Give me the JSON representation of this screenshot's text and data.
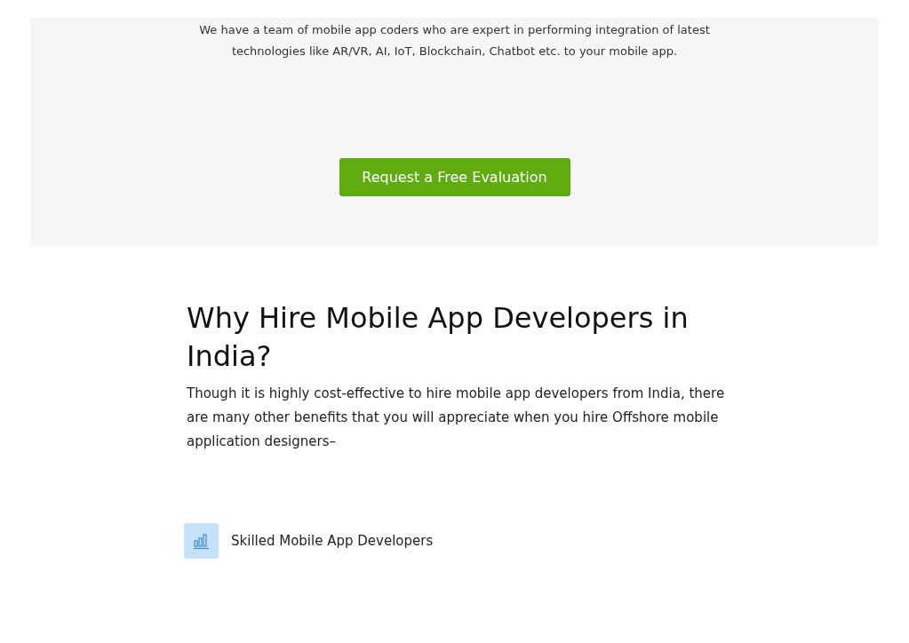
{
  "evaluation_section": {
    "description": "We have a team of mobile app coders who are expert in performing integration of latest technologies like AR/VR, AI, IoT, Blockchain, Chatbot etc. to your mobile app.",
    "button": "Request a Free Evaluation"
  },
  "why_hire_section": {
    "heading": "Why Hire Mobile App Developers in India?",
    "intro": "Though it is highly cost-effective to hire mobile app developers from India, there are many other benefits that you will appreciate when you hire Offshore mobile application designers–",
    "features": [
      {
        "title": "Skilled Mobile App Developers"
      }
    ]
  }
}
